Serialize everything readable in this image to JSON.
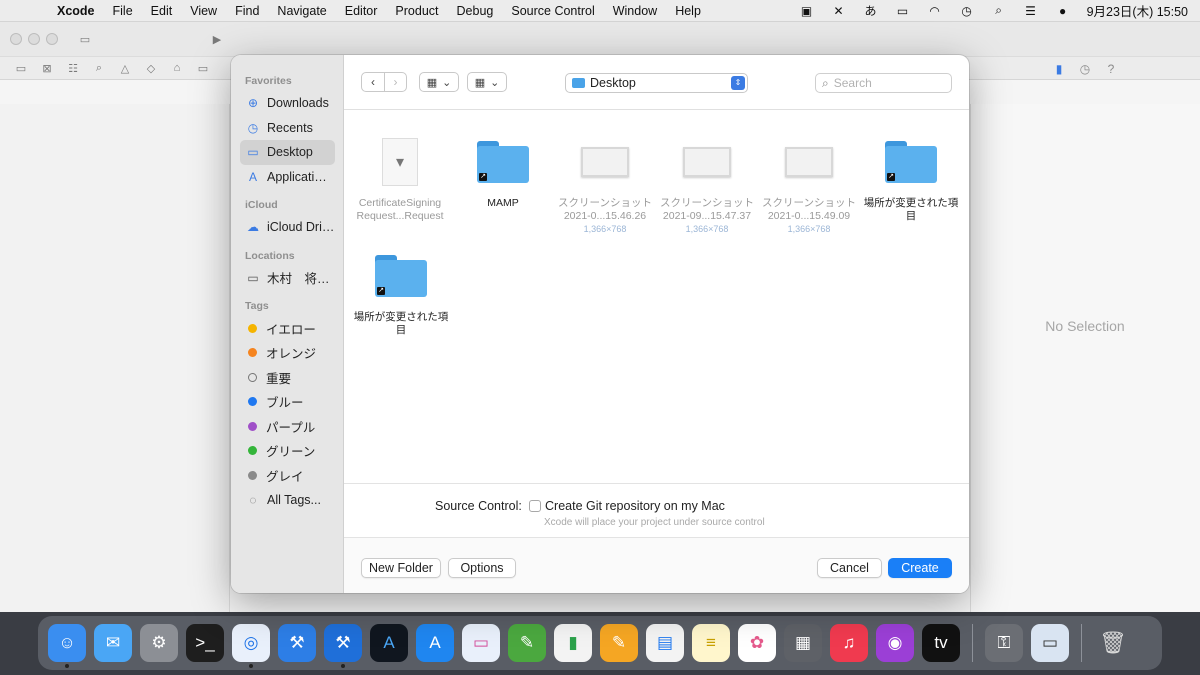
{
  "menubar": {
    "app": "Xcode",
    "items": [
      "File",
      "Edit",
      "View",
      "Find",
      "Navigate",
      "Editor",
      "Product",
      "Debug",
      "Source Control",
      "Window",
      "Help"
    ],
    "input_method": "あ",
    "clock": "9月23日(木)  15:50"
  },
  "xcode": {
    "no_selection": "No Selection"
  },
  "dialog": {
    "sidebar": {
      "favorites_header": "Favorites",
      "favorites": [
        "Downloads",
        "Recents",
        "Desktop",
        "Applicati…"
      ],
      "icloud_header": "iCloud",
      "icloud": [
        "iCloud Dri…"
      ],
      "locations_header": "Locations",
      "locations": [
        "木村　将…"
      ],
      "tags_header": "Tags",
      "tags": [
        {
          "label": "イエロー",
          "color": "#f5b400"
        },
        {
          "label": "オレンジ",
          "color": "#f5841f"
        },
        {
          "label": "重要",
          "color": ""
        },
        {
          "label": "ブルー",
          "color": "#1f78f0"
        },
        {
          "label": "パープル",
          "color": "#a050c8"
        },
        {
          "label": "グリーン",
          "color": "#34b53a"
        },
        {
          "label": "グレイ",
          "color": "#8a8a8a"
        }
      ],
      "all_tags": "All Tags..."
    },
    "toolbar": {
      "location": "Desktop",
      "search_placeholder": "Search"
    },
    "files": [
      {
        "name": "CertificateSigning Request...Request",
        "dim": true
      },
      {
        "name": "MAMP",
        "dim": false
      },
      {
        "name": "スクリーンショット 2021-0...15.46.26",
        "size": "1,366×768",
        "dim": true
      },
      {
        "name": "スクリーンショット 2021-09...15.47.37",
        "size": "1,366×768",
        "dim": true
      },
      {
        "name": "スクリーンショット 2021-0...15.49.09",
        "size": "1,366×768",
        "dim": true
      },
      {
        "name": "場所が変更された項目",
        "dim": false
      },
      {
        "name": "場所が変更された項目",
        "dim": false
      }
    ],
    "source_control": {
      "label": "Source Control:",
      "checkbox_label": "Create Git repository on my Mac",
      "hint": "Xcode will place your project under source control"
    },
    "buttons": {
      "new_folder": "New Folder",
      "options": "Options",
      "cancel": "Cancel",
      "create": "Create"
    }
  },
  "colors": {
    "accent": "#1a7ff7",
    "folder": "#5bb1ee"
  }
}
